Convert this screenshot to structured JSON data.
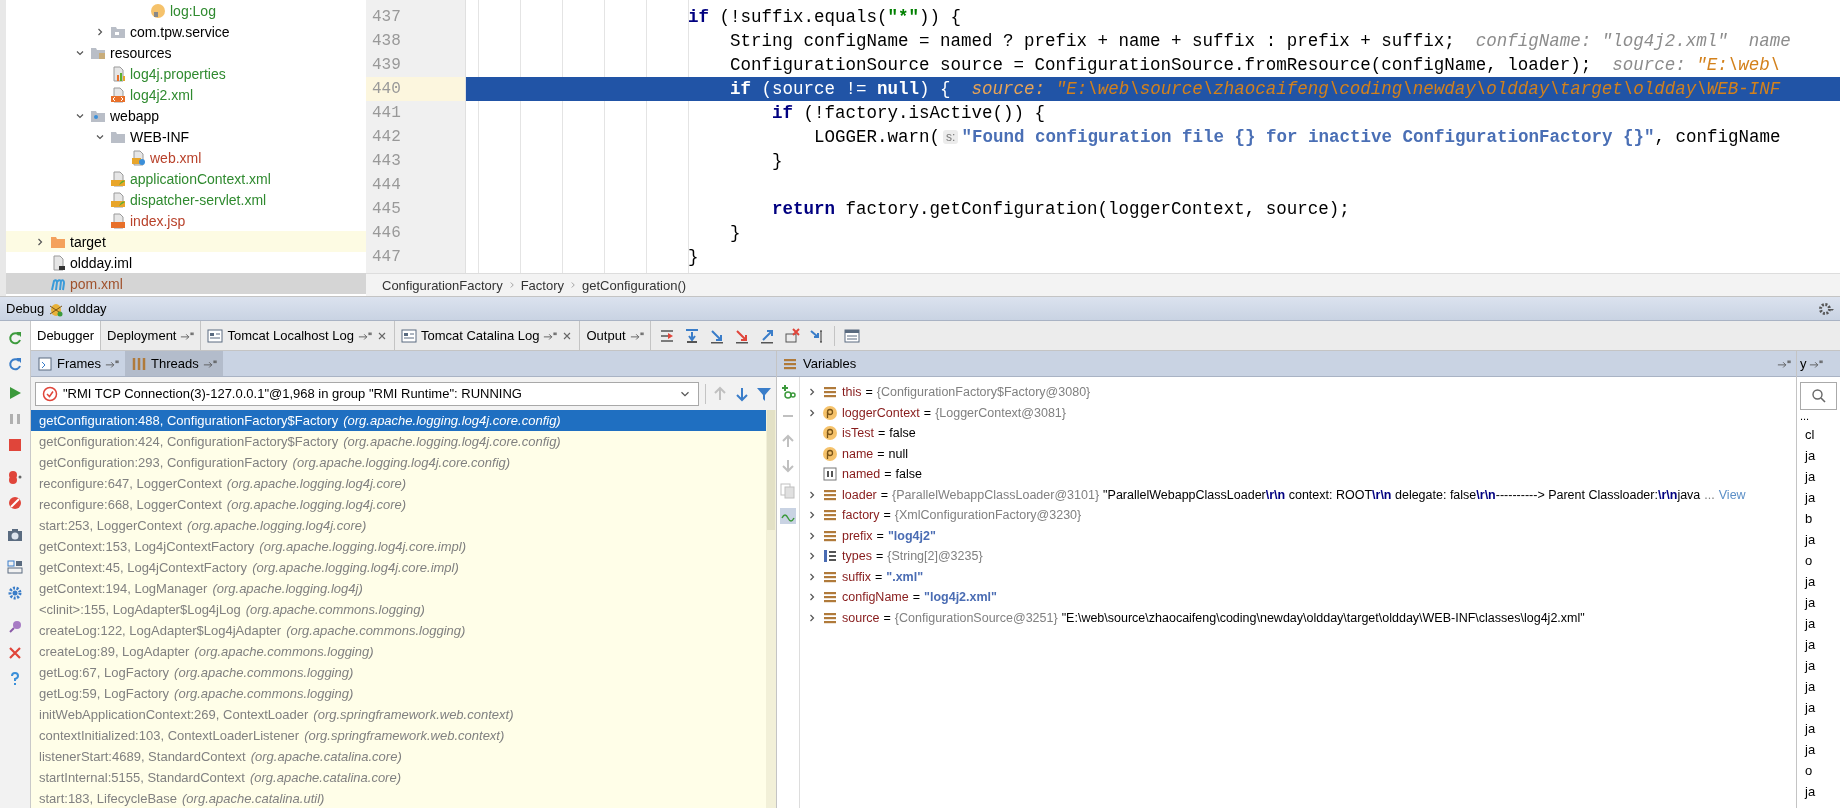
{
  "project_tree": {
    "items": [
      {
        "children": [
          {
            "children": [
              {
                "children": [
                  {
                    "children": [
                      {
                        "children": [
                          {
                            "label": "log:Log",
                            "kind": "field",
                            "color": "#2f8a2f",
                            "selected": false
                          }
                        ]
                      }
                    ]
                  },
                  {
                    "label": "com.tpw.service",
                    "kind": "package",
                    "color": "#000000",
                    "expanded": false,
                    "selected": false
                  }
                ]
              },
              {
                "label": "resources",
                "kind": "resources",
                "color": "#000000",
                "expanded": true,
                "selected": false,
                "children": [
                  {
                    "label": "log4j.properties",
                    "kind": "properties",
                    "color": "#2f8a2f",
                    "selected": false
                  },
                  {
                    "label": "log4j2.xml",
                    "kind": "xml",
                    "color": "#2f8a2f",
                    "selected": false
                  }
                ]
              },
              {
                "label": "webapp",
                "kind": "web-folder",
                "color": "#000000",
                "expanded": true,
                "selected": false,
                "children": [
                  {
                    "label": "WEB-INF",
                    "kind": "folder",
                    "color": "#000000",
                    "expanded": true,
                    "selected": false,
                    "children": [
                      {
                        "label": "web.xml",
                        "kind": "web-xml",
                        "color": "#b8412a",
                        "selected": false
                      }
                    ]
                  },
                  {
                    "label": "applicationContext.xml",
                    "kind": "spring-xml",
                    "color": "#2f8a2f",
                    "selected": false
                  },
                  {
                    "label": "dispatcher-servlet.xml",
                    "kind": "spring-xml",
                    "color": "#2f8a2f",
                    "selected": false
                  },
                  {
                    "label": "index.jsp",
                    "kind": "jsp",
                    "color": "#b8412a",
                    "selected": false
                  }
                ]
              }
            ]
          }
        ]
      },
      {
        "label": "target",
        "kind": "excluded-folder",
        "color": "#000000",
        "expanded": false,
        "selected": false
      },
      {
        "label": "oldday.iml",
        "kind": "iml",
        "color": "#000000",
        "selected": false
      },
      {
        "label": "pom.xml",
        "kind": "maven",
        "color": "#a0522d",
        "selected": true
      }
    ]
  },
  "editor": {
    "lines": [
      {
        "number": "437",
        "selected": false,
        "segments": [
          {
            "kind": "keyword",
            "text": "                    if"
          },
          {
            "kind": "plain",
            "text": " (!suffix.equals("
          },
          {
            "kind": "string",
            "text": "\"*\""
          },
          {
            "kind": "plain",
            "text": ")) {"
          }
        ]
      },
      {
        "number": "438",
        "selected": false,
        "segments": [
          {
            "kind": "plain",
            "text": "                        String configName = named ? prefix + name + suffix : prefix + suffix;"
          },
          {
            "kind": "hint-label",
            "text": "configName:"
          },
          {
            "kind": "hint-grey",
            "text": " \"log4j2.xml\""
          },
          {
            "kind": "hint-label",
            "text": "name"
          }
        ]
      },
      {
        "number": "439",
        "selected": false,
        "segments": [
          {
            "kind": "plain",
            "text": "                        ConfigurationSource source = ConfigurationSource.fromResource(configName, loader);"
          },
          {
            "kind": "hint-label",
            "text": "source:"
          },
          {
            "kind": "hint-value",
            "text": " \"E:\\web\\"
          }
        ]
      },
      {
        "number": "440",
        "selected": true,
        "segments": [
          {
            "kind": "keyword",
            "text": "                        if"
          },
          {
            "kind": "plain",
            "text": " (source != "
          },
          {
            "kind": "keyword",
            "text": "null"
          },
          {
            "kind": "plain",
            "text": ") {"
          },
          {
            "kind": "hint-label",
            "text": "source:"
          },
          {
            "kind": "hint-value",
            "text": " \"E:\\web\\source\\zhaocaifeng\\coding\\newday\\oldday\\target\\oldday\\WEB-INF"
          }
        ]
      },
      {
        "number": "441",
        "selected": false,
        "segments": [
          {
            "kind": "keyword",
            "text": "                            if"
          },
          {
            "kind": "plain",
            "text": " (!factory.isActive()) {"
          }
        ]
      },
      {
        "number": "442",
        "selected": false,
        "segments": [
          {
            "kind": "plain",
            "text": "                                LOGGER.warn("
          },
          {
            "kind": "param",
            "text": "s:"
          },
          {
            "kind": "format",
            "text": "\"Found configuration file {} for inactive ConfigurationFactory {}\""
          },
          {
            "kind": "plain",
            "text": ", configName"
          }
        ]
      },
      {
        "number": "443",
        "selected": false,
        "segments": [
          {
            "kind": "plain",
            "text": "                            }"
          }
        ]
      },
      {
        "number": "444",
        "selected": false
      },
      {
        "number": "445",
        "selected": false,
        "segments": [
          {
            "kind": "keyword",
            "text": "                            return"
          },
          {
            "kind": "plain",
            "text": " factory.getConfiguration(loggerContext, source);"
          }
        ]
      },
      {
        "number": "446",
        "selected": false,
        "segments": [
          {
            "kind": "plain",
            "text": "                        }"
          }
        ]
      },
      {
        "number": "447",
        "selected": false,
        "segments": [
          {
            "kind": "plain",
            "text": "                    }"
          }
        ]
      }
    ],
    "breadcrumb": [
      "ConfigurationFactory",
      "Factory",
      "getConfiguration()"
    ]
  },
  "debug": {
    "title": "Debug",
    "config": "oldday",
    "tabs": [
      {
        "label": "Debugger",
        "kind": "plain",
        "selected": true,
        "pinnable": false,
        "closable": false
      },
      {
        "label": "Deployment",
        "kind": "plain",
        "selected": false,
        "pinnable": true,
        "closable": false
      },
      {
        "label": "Tomcat Localhost Log",
        "kind": "log",
        "selected": false,
        "pinnable": true,
        "closable": true
      },
      {
        "label": "Tomcat Catalina Log",
        "kind": "log",
        "selected": false,
        "pinnable": true,
        "closable": true
      },
      {
        "label": "Output",
        "kind": "plain",
        "selected": false,
        "pinnable": true,
        "closable": false
      }
    ],
    "frames_panel": {
      "tabs": [
        {
          "label": "Frames",
          "selected": false
        },
        {
          "label": "Threads",
          "selected": true
        }
      ],
      "thread": "\"RMI TCP Connection(3)-127.0.0.1\"@1,968 in group \"RMI Runtime\": RUNNING",
      "frames": [
        {
          "method": "getConfiguration:488, ConfigurationFactory$Factory",
          "package": "(org.apache.logging.log4j.core.config)",
          "selected": true
        },
        {
          "method": "getConfiguration:424, ConfigurationFactory$Factory",
          "package": "(org.apache.logging.log4j.core.config)",
          "selected": false
        },
        {
          "method": "getConfiguration:293, ConfigurationFactory",
          "package": "(org.apache.logging.log4j.core.config)",
          "selected": false
        },
        {
          "method": "reconfigure:647, LoggerContext",
          "package": "(org.apache.logging.log4j.core)",
          "selected": false
        },
        {
          "method": "reconfigure:668, LoggerContext",
          "package": "(org.apache.logging.log4j.core)",
          "selected": false
        },
        {
          "method": "start:253, LoggerContext",
          "package": "(org.apache.logging.log4j.core)",
          "selected": false
        },
        {
          "method": "getContext:153, Log4jContextFactory",
          "package": "(org.apache.logging.log4j.core.impl)",
          "selected": false
        },
        {
          "method": "getContext:45, Log4jContextFactory",
          "package": "(org.apache.logging.log4j.core.impl)",
          "selected": false
        },
        {
          "method": "getContext:194, LogManager",
          "package": "(org.apache.logging.log4j)",
          "selected": false
        },
        {
          "method": "<clinit>:155, LogAdapter$Log4jLog",
          "package": "(org.apache.commons.logging)",
          "selected": false
        },
        {
          "method": "createLog:122, LogAdapter$Log4jAdapter",
          "package": "(org.apache.commons.logging)",
          "selected": false
        },
        {
          "method": "createLog:89, LogAdapter",
          "package": "(org.apache.commons.logging)",
          "selected": false
        },
        {
          "method": "getLog:67, LogFactory",
          "package": "(org.apache.commons.logging)",
          "selected": false
        },
        {
          "method": "getLog:59, LogFactory",
          "package": "(org.apache.commons.logging)",
          "selected": false
        },
        {
          "method": "initWebApplicationContext:269, ContextLoader",
          "package": "(org.springframework.web.context)",
          "selected": false
        },
        {
          "method": "contextInitialized:103, ContextLoaderListener",
          "package": "(org.springframework.web.context)",
          "selected": false
        },
        {
          "method": "listenerStart:4689, StandardContext",
          "package": "(org.apache.catalina.core)",
          "selected": false
        },
        {
          "method": "startInternal:5155, StandardContext",
          "package": "(org.apache.catalina.core)",
          "selected": false
        },
        {
          "method": "start:183, LifecycleBase",
          "package": "(org.apache.catalina.util)",
          "selected": false
        }
      ]
    },
    "variables_panel": {
      "title": "Variables",
      "variables": [
        {
          "name": "this",
          "kind": "field",
          "expandable": true,
          "op": "=",
          "type": "{ConfigurationFactory$Factory@3080}"
        },
        {
          "name": "loggerContext",
          "kind": "param",
          "expandable": true,
          "op": "=",
          "type": "{LoggerContext@3081}"
        },
        {
          "name": "isTest",
          "kind": "param",
          "expandable": false,
          "op": "=",
          "value": {
            "kind": "plain",
            "text": "false"
          }
        },
        {
          "name": "name",
          "kind": "param",
          "expandable": false,
          "op": "=",
          "value": {
            "kind": "plain",
            "text": "null"
          }
        },
        {
          "name": "named",
          "kind": "local",
          "expandable": false,
          "op": "=",
          "value": {
            "kind": "plain",
            "text": "false"
          }
        },
        {
          "name": "loader",
          "kind": "field",
          "expandable": true,
          "op": "=",
          "type": "{ParallelWebappClassLoader@3101}",
          "value": {
            "kind": "rich",
            "text": "\"ParallelWebappClassLoader**\\r\\n**  context: ROOT**\\r\\n**  delegate: false**\\r\\n**----------> Parent Classloader:**\\r\\n**java"
          },
          "more": "...",
          "link": "View"
        },
        {
          "name": "factory",
          "kind": "field",
          "expandable": true,
          "op": "=",
          "type": "{XmlConfigurationFactory@3230}"
        },
        {
          "name": "prefix",
          "kind": "field",
          "expandable": true,
          "op": "=",
          "value": {
            "kind": "string",
            "text": "\"log4j2\""
          }
        },
        {
          "name": "types",
          "kind": "array",
          "expandable": true,
          "op": "=",
          "type": "{String[2]@3235}"
        },
        {
          "name": "suffix",
          "kind": "field",
          "expandable": true,
          "op": "=",
          "value": {
            "kind": "string",
            "text": "\".xml\""
          }
        },
        {
          "name": "configName",
          "kind": "field",
          "expandable": true,
          "op": "=",
          "value": {
            "kind": "string",
            "text": "\"log4j2.xml\""
          }
        },
        {
          "name": "source",
          "kind": "field",
          "expandable": true,
          "op": "=",
          "type": "{ConfigurationSource@3251}",
          "value": {
            "kind": "plain",
            "text": "\"E:\\web\\source\\zhaocaifeng\\coding\\newday\\oldday\\target\\oldday\\WEB-INF\\classes\\log4j2.xml\""
          }
        }
      ]
    },
    "side_panel": {
      "header": "y",
      "more": "...",
      "items": [
        "cl",
        "ja",
        "ja",
        "ja",
        "b",
        "ja",
        "o",
        "ja",
        "ja",
        "ja",
        "ja",
        "ja",
        "ja",
        "ja",
        "ja",
        "ja",
        "o",
        "ja"
      ]
    }
  }
}
